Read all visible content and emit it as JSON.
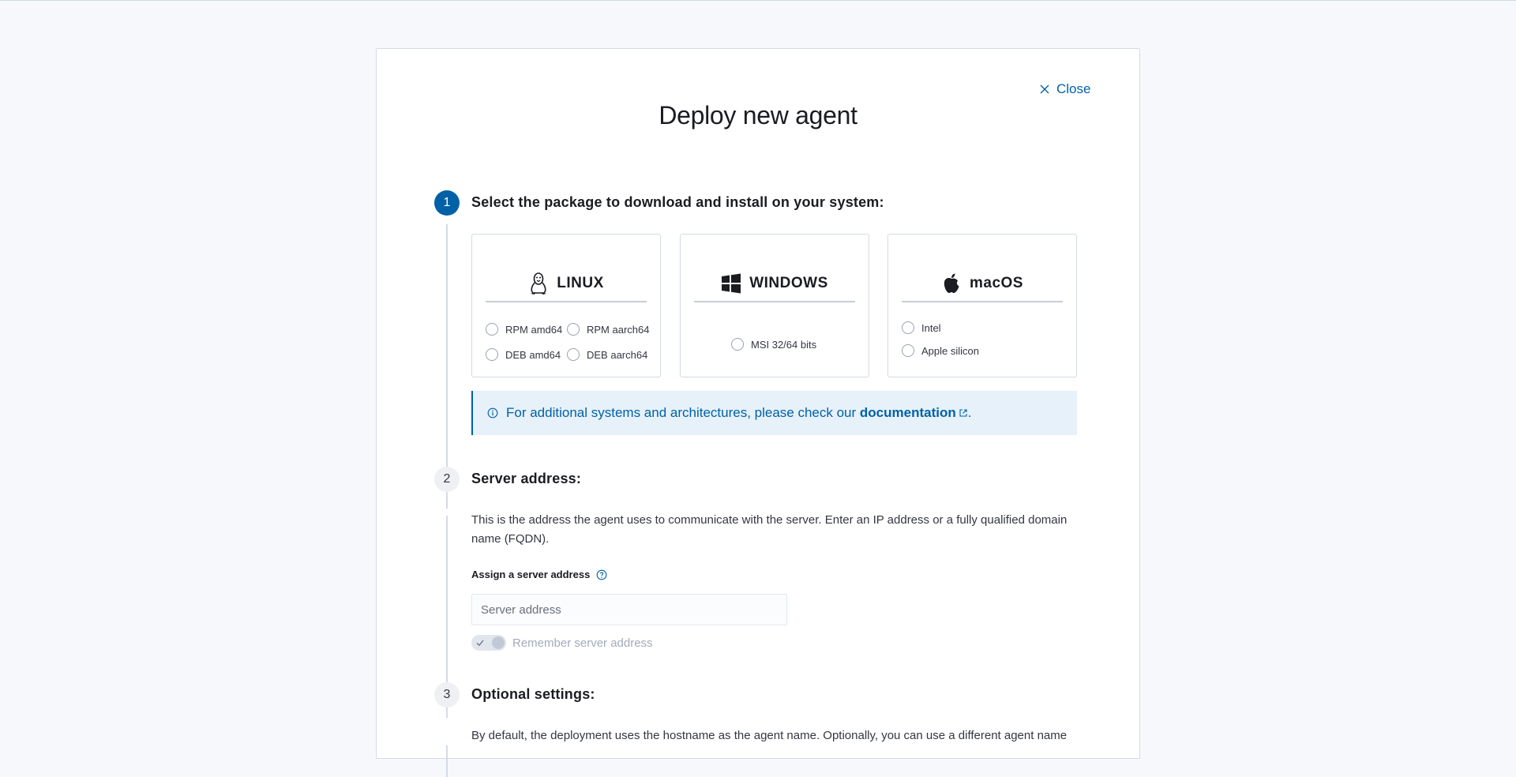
{
  "modal": {
    "close_label": "Close",
    "title": "Deploy new agent"
  },
  "steps": [
    {
      "number": "1",
      "title": "Select the package to download and install on your system:",
      "state": "active"
    },
    {
      "number": "2",
      "title": "Server address:",
      "state": "inactive"
    },
    {
      "number": "3",
      "title": "Optional settings:",
      "state": "inactive"
    }
  ],
  "os_cards": {
    "linux": {
      "name": "LINUX",
      "icon": "linux-tux-icon",
      "options": [
        "RPM amd64",
        "RPM aarch64",
        "DEB amd64",
        "DEB aarch64"
      ]
    },
    "windows": {
      "name": "WINDOWS",
      "icon": "windows-logo-icon",
      "options": [
        "MSI 32/64 bits"
      ]
    },
    "macos": {
      "name": "macOS",
      "icon": "apple-logo-icon",
      "options": [
        "Intel",
        "Apple silicon"
      ]
    }
  },
  "callout": {
    "text": "For additional systems and architectures, please check our",
    "link": "documentation",
    "suffix": ".",
    "icon": "info-icon"
  },
  "server": {
    "description": "This is the address the agent uses to communicate with the server. Enter an IP address or a fully qualified domain name (FQDN).",
    "field_label": "Assign a server address",
    "placeholder": "Server address",
    "value": "",
    "toggle_label": "Remember server address",
    "toggle_checked": true
  },
  "optional": {
    "description": "By default, the deployment uses the hostname as the agent name. Optionally, you can use a different agent name"
  },
  "colors": {
    "accent": "#0061a6",
    "callout_bg": "#e6f1fa",
    "border": "#d3dae6"
  }
}
